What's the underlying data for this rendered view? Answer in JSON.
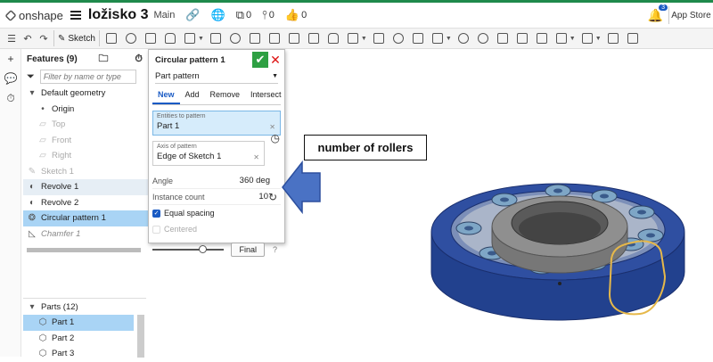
{
  "header": {
    "brand": "onshape",
    "doc_title": "ložisko 3",
    "branch": "Main",
    "versions_count": "0",
    "branches_count": "0",
    "likes_count": "0",
    "notification_count": "3",
    "app_store_label": "App Store"
  },
  "toolbar": {
    "sketch_label": "Sketch"
  },
  "features": {
    "title": "Features (9)",
    "filter_placeholder": "Filter by name or type",
    "default_geometry": "Default geometry",
    "items": [
      {
        "label": "Origin"
      },
      {
        "label": "Top"
      },
      {
        "label": "Front"
      },
      {
        "label": "Right"
      },
      {
        "label": "Sketch 1"
      },
      {
        "label": "Revolve 1"
      },
      {
        "label": "Revolve 2"
      },
      {
        "label": "Circular pattern 1"
      },
      {
        "label": "Chamfer 1"
      }
    ]
  },
  "parts": {
    "title": "Parts (12)",
    "items": [
      {
        "label": "Part 1"
      },
      {
        "label": "Part 2"
      },
      {
        "label": "Part 3"
      }
    ]
  },
  "panel": {
    "title": "Circular pattern 1",
    "pattern_type": "Part pattern",
    "tabs": [
      "New",
      "Add",
      "Remove",
      "Intersect"
    ],
    "entities_label": "Entities to pattern",
    "entities_value": "Part 1",
    "axis_label": "Axis of pattern",
    "axis_value": "Edge of Sketch 1",
    "angle_label": "Angle",
    "angle_value": "360 deg",
    "count_label": "Instance count",
    "count_value": "10",
    "equal_spacing_label": "Equal spacing",
    "centered_label": "Centered",
    "final_label": "Final",
    "slider_position": 0.7
  },
  "annotation": {
    "callout_text": "number of rollers",
    "arrow_color": "#4a72c4"
  },
  "colors": {
    "accent": "#1a5bc4",
    "ok": "#2ea043",
    "selected_row": "#a9d4f5",
    "bearing_blue": "#2b4a9c",
    "highlight_outline": "#e6b84a"
  }
}
